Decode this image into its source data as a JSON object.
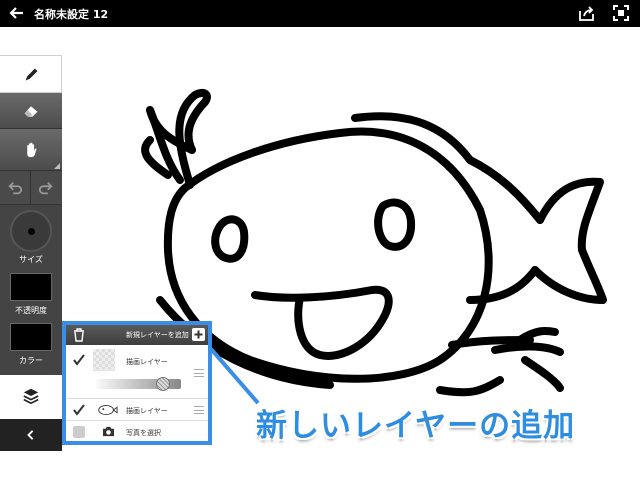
{
  "header": {
    "title": "名称未設定 12",
    "back_icon": "arrow-left-icon",
    "share_icon": "share-icon",
    "fullscreen_icon": "fullscreen-icon"
  },
  "toolbar": {
    "tools": [
      "pen-icon",
      "eraser-icon",
      "hand-icon",
      "undo-icon",
      "redo-icon"
    ],
    "size_label": "サイズ",
    "opacity_label": "不透明度",
    "color_label": "カラー",
    "layers_icon": "layers-icon",
    "collapse_icon": "chevron-left-icon"
  },
  "layer_panel": {
    "add_layer_label": "新規レイヤーを追加",
    "layers": [
      {
        "name": "描画レイヤー",
        "visible": true
      },
      {
        "name": "描画レイヤー",
        "visible": true
      },
      {
        "name": "写真を選択",
        "visible": false
      }
    ],
    "opacity_fraction": 0.85
  },
  "annotation": {
    "text": "新しいレイヤーの追加",
    "color": "#2f8de0"
  }
}
